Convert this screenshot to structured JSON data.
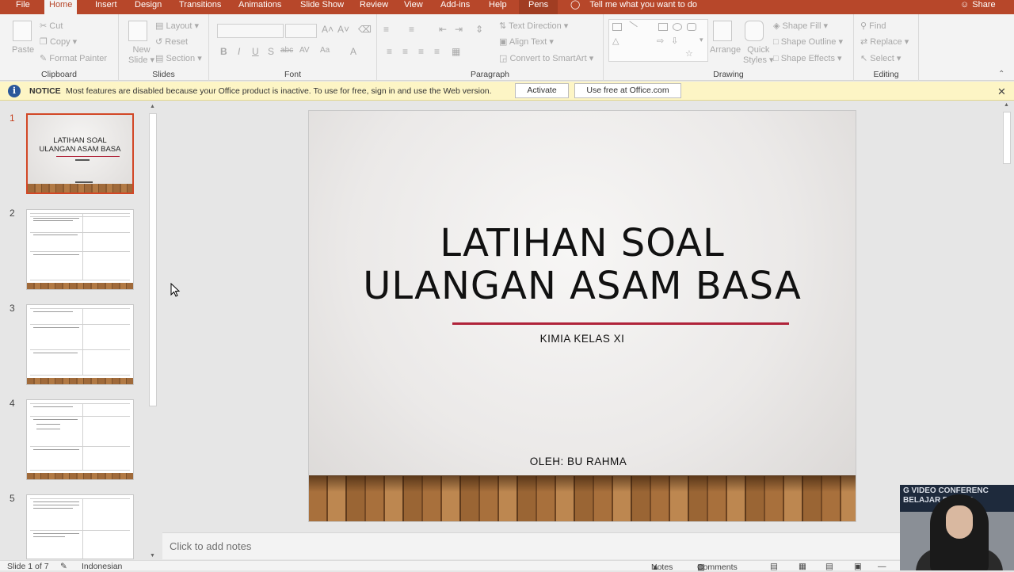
{
  "tabs": [
    {
      "label": "File"
    },
    {
      "label": "Home"
    },
    {
      "label": "Insert"
    },
    {
      "label": "Design"
    },
    {
      "label": "Transitions"
    },
    {
      "label": "Animations"
    },
    {
      "label": "Slide Show"
    },
    {
      "label": "Review"
    },
    {
      "label": "View"
    },
    {
      "label": "Add-ins"
    },
    {
      "label": "Help"
    },
    {
      "label": "Pens"
    }
  ],
  "active_tab": "Home",
  "tell_me": "Tell me what you want to do",
  "share": "Share",
  "ribbon": {
    "clipboard": {
      "label": "Clipboard",
      "paste": "Paste",
      "cut": "Cut",
      "copy": "Copy",
      "format_painter": "Format Painter"
    },
    "slides": {
      "label": "Slides",
      "new_slide_1": "New",
      "new_slide_2": "Slide",
      "layout": "Layout",
      "reset": "Reset",
      "section": "Section"
    },
    "font": {
      "label": "Font"
    },
    "paragraph": {
      "label": "Paragraph",
      "text_direction": "Text Direction",
      "align_text": "Align Text",
      "convert_smartart": "Convert to SmartArt"
    },
    "drawing": {
      "label": "Drawing",
      "arrange": "Arrange",
      "quick_styles_1": "Quick",
      "quick_styles_2": "Styles",
      "shape_fill": "Shape Fill",
      "shape_outline": "Shape Outline",
      "shape_effects": "Shape Effects"
    },
    "editing": {
      "label": "Editing",
      "find": "Find",
      "replace": "Replace",
      "select": "Select"
    }
  },
  "notice": {
    "title": "NOTICE",
    "message": "Most features are disabled because your Office product is inactive. To use for free, sign in and use the Web version.",
    "activate": "Activate",
    "use_free": "Use free at Office.com"
  },
  "thumbnails": [
    {
      "number": "1",
      "title_1": "LATIHAN SOAL",
      "title_2": "ULANGAN ASAM BASA"
    },
    {
      "number": "2"
    },
    {
      "number": "3"
    },
    {
      "number": "4"
    },
    {
      "number": "5"
    }
  ],
  "slide": {
    "title_line1": "LATIHAN SOAL",
    "title_line2": "ULANGAN ASAM BASA",
    "subtitle": "KIMIA KELAS XI",
    "author": "OLEH: BU RAHMA"
  },
  "notes_placeholder": "Click to add notes",
  "status": {
    "slide_of": "Slide 1 of 7",
    "language": "Indonesian",
    "notes": "Notes",
    "comments": "Comments"
  },
  "webcam": {
    "banner_1": "G VIDEO CONFERENC",
    "banner_2": "BELAJAR D RUMA"
  },
  "colors": {
    "accent": "#b7472a",
    "notice_bg": "#fdf5c5",
    "slide_rule": "#b0233a"
  }
}
